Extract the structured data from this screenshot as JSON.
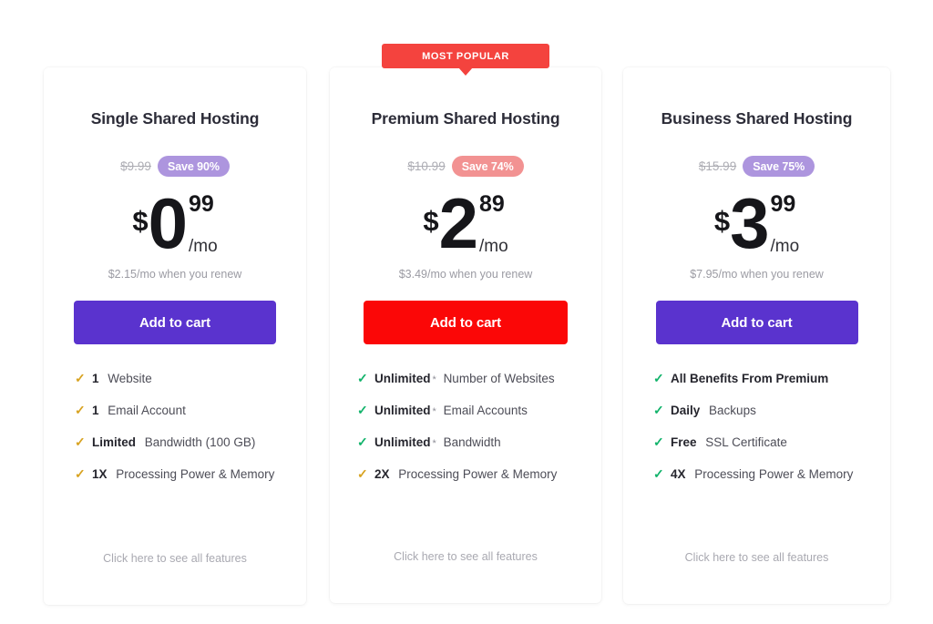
{
  "badge": {
    "label": "MOST POPULAR",
    "color": "#f4433e"
  },
  "colors": {
    "purple_cta": "#5a33ce",
    "red_cta": "#fb0707",
    "pill_purple": "#ad95de",
    "pill_pink": "#f29292",
    "check_gold": "#d8a321",
    "check_green": "#12b36b"
  },
  "plans": [
    {
      "title": "Single Shared Hosting",
      "old_price": "$9.99",
      "save_label": "Save 90%",
      "currency": "$",
      "price_int": "0",
      "price_cents": "99",
      "per": "/mo",
      "renew": "$2.15/mo when you renew",
      "cta": "Add to cart",
      "see_all": "Click here to see all features",
      "features": [
        {
          "check": "check-icon",
          "strong": "1",
          "star": "",
          "rest": "Website"
        },
        {
          "check": "check-icon",
          "strong": "1",
          "star": "",
          "rest": "Email Account"
        },
        {
          "check": "check-icon",
          "strong": "Limited",
          "star": "",
          "rest": "Bandwidth (100 GB)"
        },
        {
          "check": "check-icon",
          "strong": "1X",
          "star": "",
          "rest": "Processing Power & Memory"
        }
      ]
    },
    {
      "title": "Premium Shared Hosting",
      "old_price": "$10.99",
      "save_label": "Save 74%",
      "currency": "$",
      "price_int": "2",
      "price_cents": "89",
      "per": "/mo",
      "renew": "$3.49/mo when you renew",
      "cta": "Add to cart",
      "see_all": "Click here to see all features",
      "features": [
        {
          "check": "check-icon",
          "strong": "Unlimited",
          "star": "*",
          "rest": "Number of Websites"
        },
        {
          "check": "check-icon",
          "strong": "Unlimited",
          "star": "*",
          "rest": "Email Accounts"
        },
        {
          "check": "check-icon",
          "strong": "Unlimited",
          "star": "*",
          "rest": "Bandwidth"
        },
        {
          "check": "check-icon",
          "strong": "2X",
          "star": "",
          "rest": "Processing Power & Memory"
        }
      ]
    },
    {
      "title": "Business Shared Hosting",
      "old_price": "$15.99",
      "save_label": "Save 75%",
      "currency": "$",
      "price_int": "3",
      "price_cents": "99",
      "per": "/mo",
      "renew": "$7.95/mo when you renew",
      "cta": "Add to cart",
      "see_all": "Click here to see all features",
      "features": [
        {
          "check": "check-icon",
          "strong": "All Benefits From Premium",
          "star": "",
          "rest": ""
        },
        {
          "check": "check-icon",
          "strong": "Daily",
          "star": "",
          "rest": "Backups"
        },
        {
          "check": "check-icon",
          "strong": "Free",
          "star": "",
          "rest": "SSL Certificate"
        },
        {
          "check": "check-icon",
          "strong": "4X",
          "star": "",
          "rest": "Processing Power & Memory"
        }
      ]
    }
  ]
}
